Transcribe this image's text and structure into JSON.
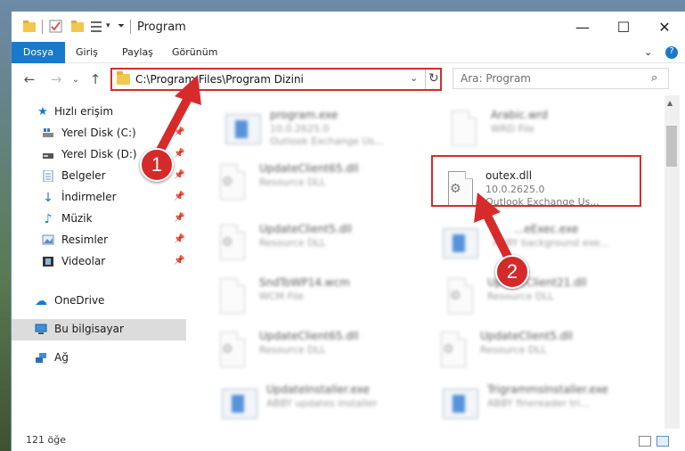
{
  "window": {
    "title": "Program",
    "controls": {
      "minimize": "—",
      "maximize": "☐",
      "close": "✕"
    }
  },
  "ribbon": {
    "tabs": [
      "Dosya",
      "Giriş",
      "Paylaş",
      "Görünüm"
    ],
    "help": "?"
  },
  "navigation": {
    "back": "←",
    "forward": "→",
    "recent": "⌄",
    "up": "↑",
    "address": "C:\\Program Files\\Program Dizini",
    "dropdown": "⌄",
    "refresh": "↻",
    "search_placeholder": "Ara: Program",
    "search_icon": "⌕"
  },
  "sidebar": {
    "quick_access": "Hızlı erişim",
    "items": [
      {
        "label": "Yerel Disk (C:)",
        "icon": "drive-icon"
      },
      {
        "label": "Yerel Disk (D:)",
        "icon": "drive-icon"
      },
      {
        "label": "Belgeler",
        "icon": "documents-icon"
      },
      {
        "label": "İndirmeler",
        "icon": "downloads-icon"
      },
      {
        "label": "Müzik",
        "icon": "music-icon"
      },
      {
        "label": "Resimler",
        "icon": "pictures-icon"
      },
      {
        "label": "Videolar",
        "icon": "videos-icon"
      }
    ],
    "onedrive": "OneDrive",
    "this_pc": "Bu bilgisayar",
    "network": "Ağ"
  },
  "files": [
    {
      "name": "program.exe",
      "line2": "10.0.2625.0",
      "line3": "Outlook Exchange Us...",
      "icon": "installer-icon"
    },
    {
      "name": "Arabic.wrd",
      "line2": "WRD File",
      "line3": "",
      "icon": "file-icon"
    },
    {
      "name": "UpdateClient65.dll",
      "line2": "Resource DLL",
      "line3": "",
      "icon": "dll-icon"
    },
    {
      "name": "outex.dll",
      "line2": "10.0.2625.0",
      "line3": "Outlook Exchange Us...",
      "icon": "dll-icon"
    },
    {
      "name": "UpdateClient5.dll",
      "line2": "Resource DLL",
      "line3": "",
      "icon": "dll-icon"
    },
    {
      "name": "...eExec.exe",
      "line2": "ABBY background exe...",
      "line3": "",
      "icon": "app-icon"
    },
    {
      "name": "SndToWP14.wcm",
      "line2": "WCM File",
      "line3": "",
      "icon": "file-icon"
    },
    {
      "name": "UpdateClient21.dll",
      "line2": "Resource DLL",
      "line3": "",
      "icon": "dll-icon"
    },
    {
      "name": "UpdateClient65.dll",
      "line2": "Resource DLL",
      "line3": "",
      "icon": "dll-icon"
    },
    {
      "name": "UpdateClient5.dll",
      "line2": "Resource DLL",
      "line3": "",
      "icon": "dll-icon"
    },
    {
      "name": "UpdateInstaller.exe",
      "line2": "ABBY updates installer",
      "line3": "",
      "icon": "app-icon"
    },
    {
      "name": "TrigrammsInstaller.exe",
      "line2": "ABBY finereader tri...",
      "line3": "",
      "icon": "app-icon"
    }
  ],
  "status": {
    "count": "121 öğe"
  },
  "annotations": {
    "step1": "1",
    "step2": "2",
    "color": "#d72b2b"
  }
}
